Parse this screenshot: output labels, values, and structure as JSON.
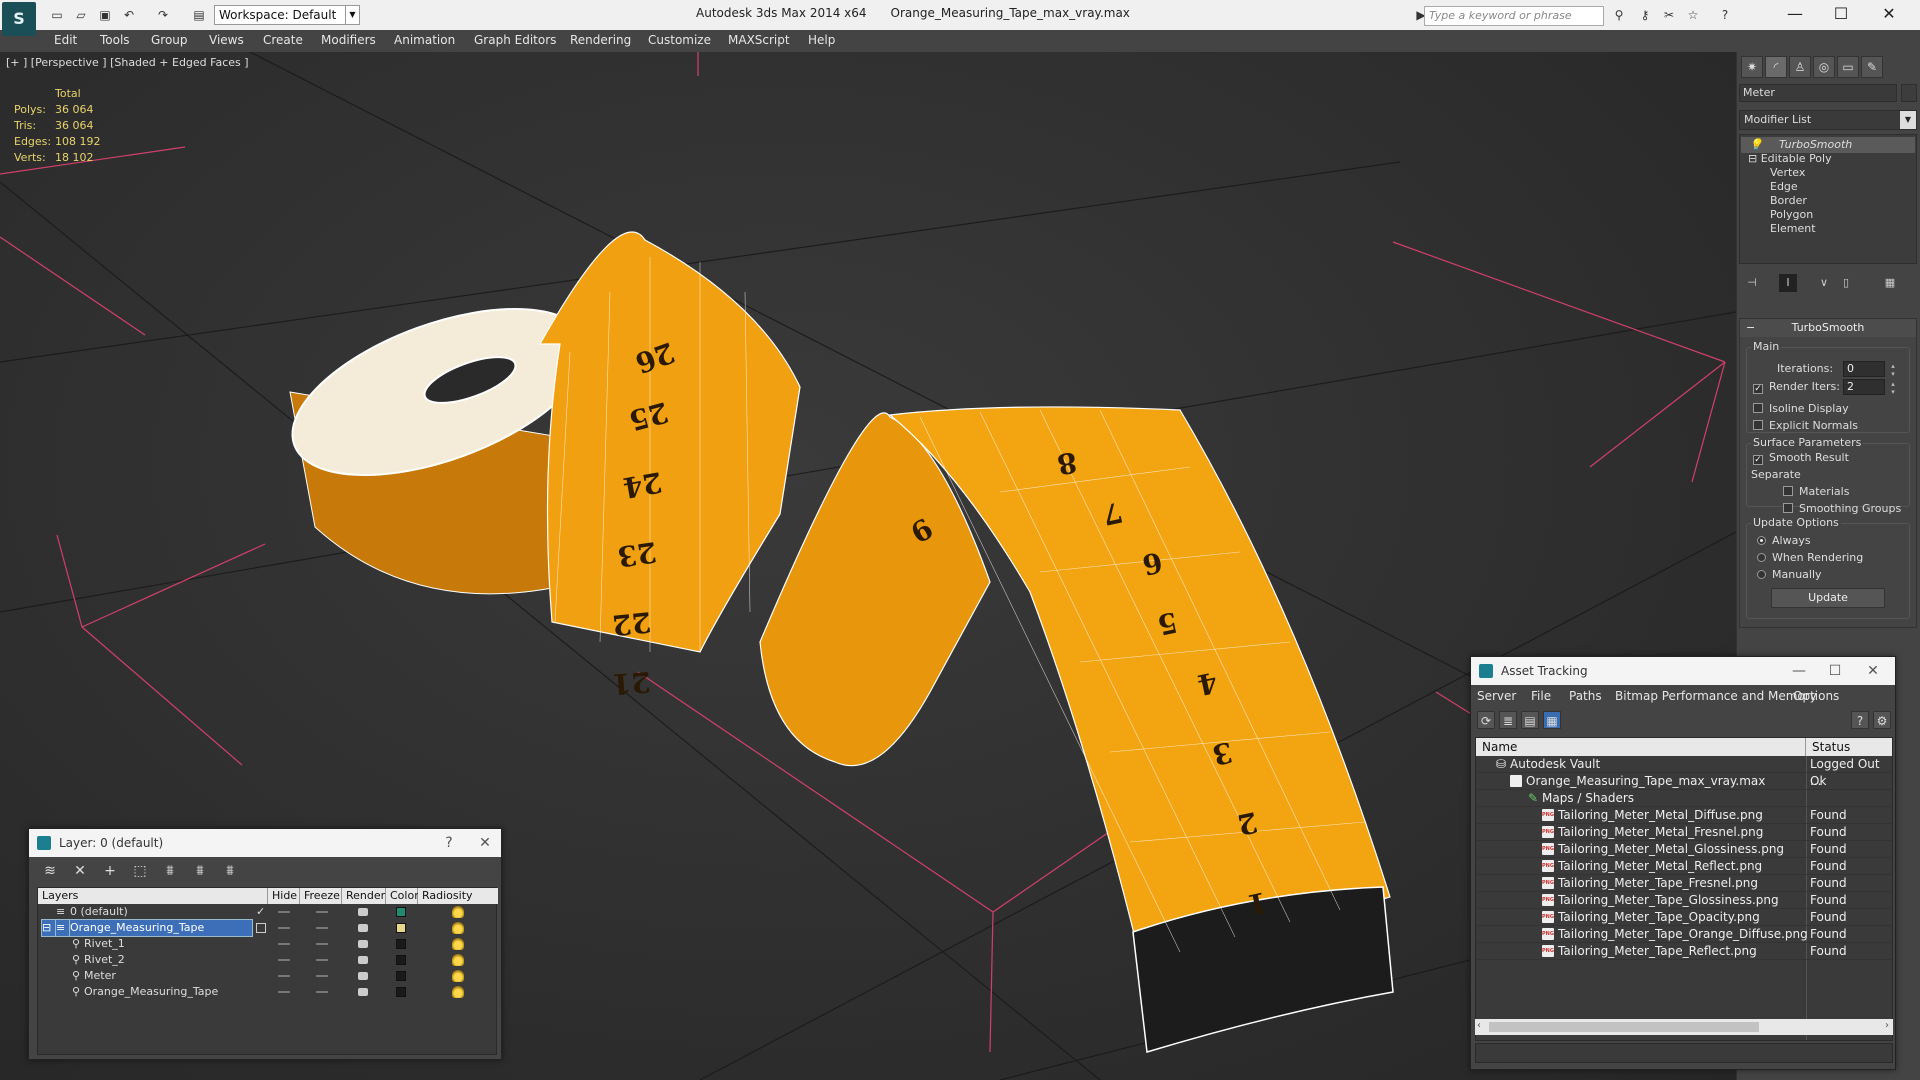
{
  "titlebar": {
    "workspace": "Workspace: Default",
    "app_name": "Autodesk 3ds Max  2014 x64",
    "file_name": "Orange_Measuring_Tape_max_vray.max",
    "search_placeholder": "Type a keyword or phrase",
    "minimize": "—",
    "maximize": "☐",
    "close": "✕"
  },
  "menubar": {
    "items": [
      "Edit",
      "Tools",
      "Group",
      "Views",
      "Create",
      "Modifiers",
      "Animation",
      "Graph Editors",
      "Rendering",
      "Customize",
      "MAXScript",
      "Help"
    ]
  },
  "viewport": {
    "label": "[+ ] [Perspective ] [Shaded + Edged Faces ]",
    "stats": {
      "header": "Total",
      "rows": [
        {
          "k": "Polys:",
          "v": "36 064"
        },
        {
          "k": "Tris:",
          "v": "36 064"
        },
        {
          "k": "Edges:",
          "v": "108 192"
        },
        {
          "k": "Verts:",
          "v": "18 102"
        }
      ]
    },
    "tape_numbers": [
      "26",
      "25",
      "24",
      "23",
      "22",
      "21",
      "9",
      "8",
      "7",
      "6",
      "5",
      "4",
      "3",
      "2",
      "1"
    ]
  },
  "command_panel": {
    "object_name": "Meter",
    "modifier_list": "Modifier List",
    "stack": [
      "TurboSmooth",
      "Editable Poly",
      "Vertex",
      "Edge",
      "Border",
      "Polygon",
      "Element"
    ],
    "rollout_title": "TurboSmooth",
    "main_group": "Main",
    "iterations_label": "Iterations:",
    "iterations_value": "0",
    "render_iters_label": "Render Iters:",
    "render_iters_value": "2",
    "isoline_display": "Isoline Display",
    "explicit_normals": "Explicit Normals",
    "surface_params_group": "Surface Parameters",
    "smooth_result": "Smooth Result",
    "separate_label": "Separate",
    "materials": "Materials",
    "smoothing_groups": "Smoothing Groups",
    "update_options_group": "Update Options",
    "always": "Always",
    "when_rendering": "When Rendering",
    "manually": "Manually",
    "update_button": "Update"
  },
  "layer_window": {
    "title": "Layer: 0 (default)",
    "help": "?",
    "close": "✕",
    "columns": [
      "Layers",
      "Hide",
      "Freeze",
      "Render",
      "Color",
      "Radiosity"
    ],
    "rows": [
      {
        "name": "0 (default)",
        "color": "#1f8a6f",
        "check": "✓"
      },
      {
        "name": "Orange_Measuring_Tape",
        "color": "#e6d78a",
        "selected": true
      },
      {
        "name": "Rivet_1",
        "color": "#1a1a1a"
      },
      {
        "name": "Rivet_2",
        "color": "#1a1a1a"
      },
      {
        "name": "Meter",
        "color": "#1a1a1a"
      },
      {
        "name": "Orange_Measuring_Tape",
        "color": "#1a1a1a"
      }
    ]
  },
  "asset_window": {
    "title": "Asset Tracking",
    "menu": [
      "Server",
      "File",
      "Paths",
      "Bitmap Performance and Memory",
      "Options"
    ],
    "columns": [
      "Name",
      "Status"
    ],
    "rows": [
      {
        "name": "Autodesk Vault",
        "status": "Logged Out ...",
        "indent": 0,
        "icon": "vault"
      },
      {
        "name": "Orange_Measuring_Tape_max_vray.max",
        "status": "Ok",
        "indent": 1,
        "icon": "max"
      },
      {
        "name": "Maps / Shaders",
        "status": "",
        "indent": 2,
        "icon": "maps"
      },
      {
        "name": "Tailoring_Meter_Metal_Diffuse.png",
        "status": "Found",
        "indent": 3,
        "icon": "png"
      },
      {
        "name": "Tailoring_Meter_Metal_Fresnel.png",
        "status": "Found",
        "indent": 3,
        "icon": "png"
      },
      {
        "name": "Tailoring_Meter_Metal_Glossiness.png",
        "status": "Found",
        "indent": 3,
        "icon": "png"
      },
      {
        "name": "Tailoring_Meter_Metal_Reflect.png",
        "status": "Found",
        "indent": 3,
        "icon": "png"
      },
      {
        "name": "Tailoring_Meter_Tape_Fresnel.png",
        "status": "Found",
        "indent": 3,
        "icon": "png"
      },
      {
        "name": "Tailoring_Meter_Tape_Glossiness.png",
        "status": "Found",
        "indent": 3,
        "icon": "png"
      },
      {
        "name": "Tailoring_Meter_Tape_Opacity.png",
        "status": "Found",
        "indent": 3,
        "icon": "png"
      },
      {
        "name": "Tailoring_Meter_Tape_Orange_Diffuse.png",
        "status": "Found",
        "indent": 3,
        "icon": "png"
      },
      {
        "name": "Tailoring_Meter_Tape_Reflect.png",
        "status": "Found",
        "indent": 3,
        "icon": "png"
      }
    ]
  },
  "colors": {
    "tape_orange": "#f0a010",
    "stats_yellow": "#e8d36a",
    "selection_blue": "#3d6fb8",
    "grid_pink": "#d0406a"
  }
}
